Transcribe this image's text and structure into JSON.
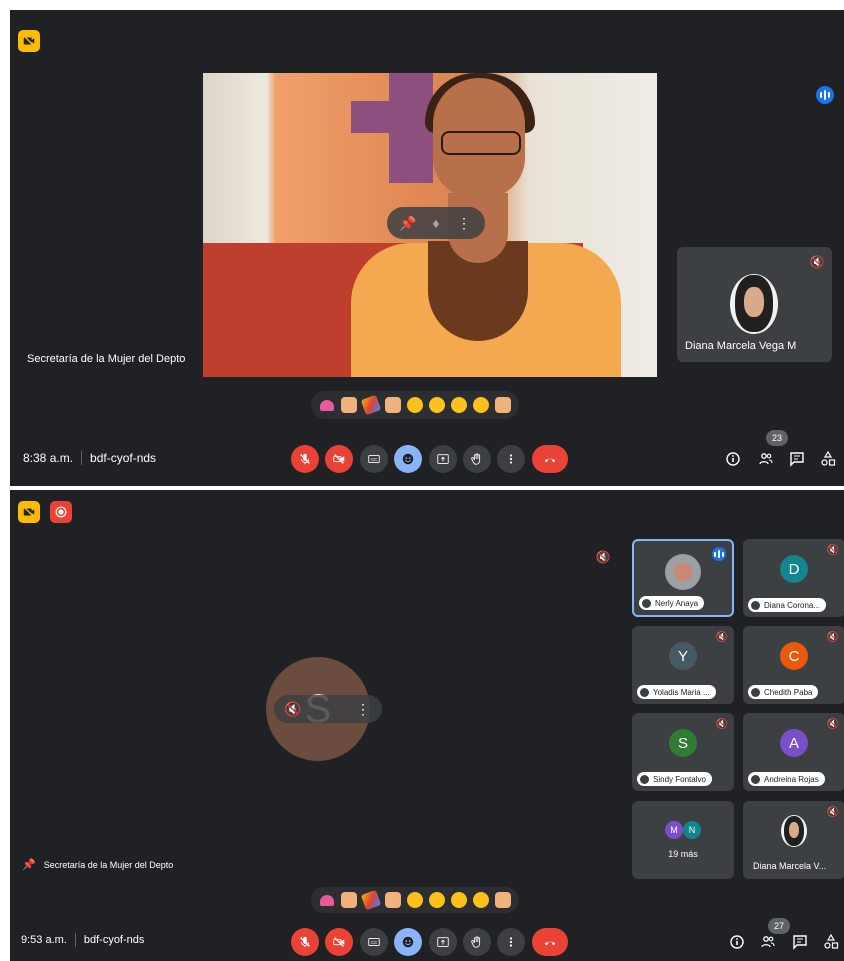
{
  "panel1": {
    "left_name": "Secretaría de la Mujer del Depto",
    "pip_name": "Diana Marcela Vega M",
    "time": "8:38 a.m.",
    "meeting_code": "bdf-cyof-nds",
    "participants_count": "23"
  },
  "panel2": {
    "big_avatar_letter": "S",
    "left_name": "Secretaría de la Mujer del Depto",
    "time": "9:53 a.m.",
    "meeting_code": "bdf-cyof-nds",
    "participants_count": "27",
    "tiles": [
      {
        "name": "Nerly Anaya",
        "letter": "",
        "color": "#8a8a8a"
      },
      {
        "name": "Diana Corona...",
        "letter": "D",
        "color": "#12858f"
      },
      {
        "name": "Yoladis Maria ...",
        "letter": "Y",
        "color": "#455a64"
      },
      {
        "name": "Chedith Paba",
        "letter": "C",
        "color": "#e8590c"
      },
      {
        "name": "Sindy Fontalvo",
        "letter": "S",
        "color": "#2e7d32"
      },
      {
        "name": "Andreina Rojas",
        "letter": "A",
        "color": "#7b4fc9"
      },
      {
        "name": "19 más",
        "letter": "",
        "color": ""
      },
      {
        "name": "Diana Marcela V...",
        "letter": "",
        "color": ""
      }
    ],
    "more_avatars": [
      {
        "letter": "M",
        "color": "#7b4fc9"
      },
      {
        "letter": "N",
        "color": "#12858f"
      }
    ]
  },
  "colors": {
    "background": "#202124",
    "tile": "#3c4043",
    "red": "#ea4335",
    "accent_blue": "#8ab4f8",
    "yellow_tag": "#fbbc04"
  }
}
